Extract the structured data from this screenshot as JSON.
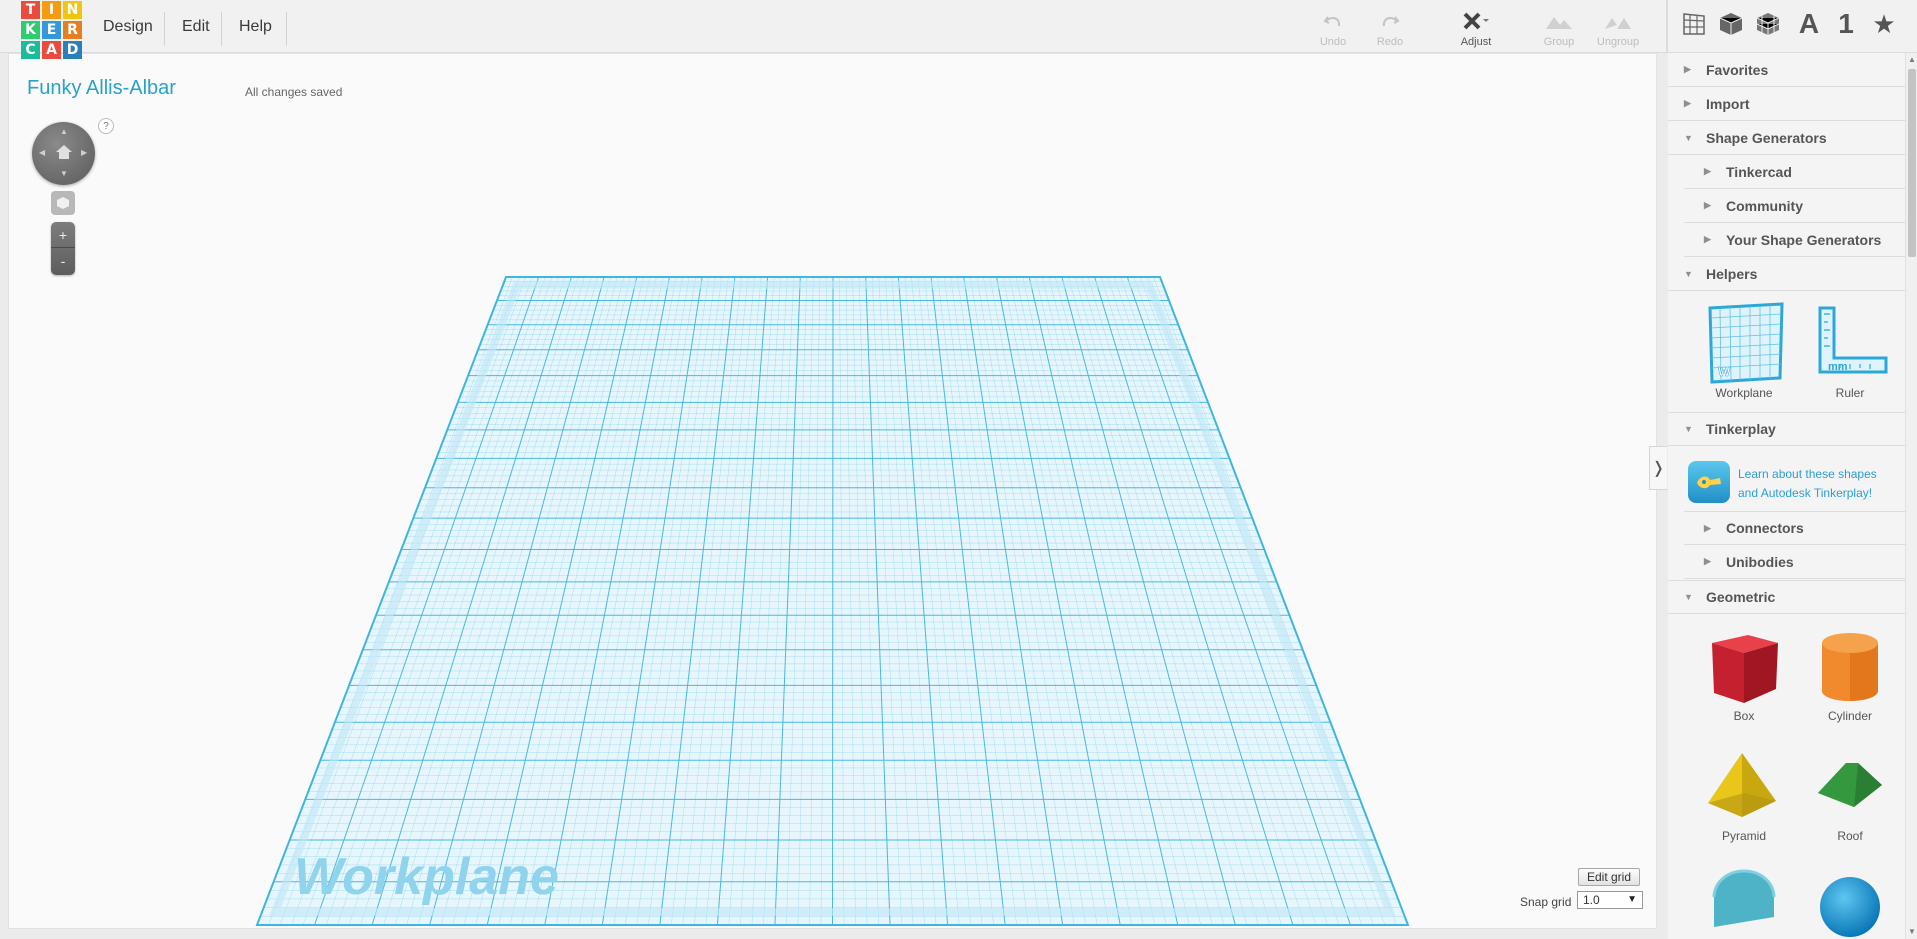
{
  "logo": {
    "letters": [
      "T",
      "I",
      "N",
      "K",
      "E",
      "R",
      "C",
      "A",
      "D"
    ],
    "colors": [
      "#e94c3c",
      "#f39c12",
      "#f1c40f",
      "#2ecc71",
      "#3498db",
      "#e67e22",
      "#1abc9c",
      "#e74c3c",
      "#2980b9"
    ]
  },
  "menu": {
    "design": "Design",
    "edit": "Edit",
    "help": "Help"
  },
  "toolbar": {
    "undo": "Undo",
    "redo": "Redo",
    "adjust": "Adjust",
    "group": "Group",
    "ungroup": "Ungroup"
  },
  "view_buttons": {
    "grid_icon": "grid-view-icon",
    "box_icon": "solid-view-icon",
    "wire_icon": "wireframe-view-icon",
    "text": "A",
    "number": "1",
    "star": "★"
  },
  "design": {
    "title": "Funky Allis-Albar",
    "status": "All changes saved"
  },
  "nav": {
    "help": "?",
    "zoom_in": "+",
    "zoom_out": "-"
  },
  "workplane": {
    "label": "Workplane",
    "color": "#3fb6dc"
  },
  "grid": {
    "edit_label": "Edit grid",
    "snap_label": "Snap grid",
    "snap_value": "1.0"
  },
  "collapse": {
    "glyph": "❭"
  },
  "sidebar": {
    "favorites": "Favorites",
    "import": "Import",
    "shape_generators": "Shape Generators",
    "tinkercad": "Tinkercad",
    "community": "Community",
    "your_generators": "Your Shape Generators",
    "helpers": "Helpers",
    "helper_items": [
      "Workplane",
      "Ruler"
    ],
    "workplane_letter": "W",
    "ruler_unit": "mm",
    "tinkerplay": "Tinkerplay",
    "tinkerplay_text": "Learn about these shapes and Autodesk Tinkerplay!",
    "connectors": "Connectors",
    "unibodies": "Unibodies",
    "geometric": "Geometric",
    "shapes": [
      "Box",
      "Cylinder",
      "Pyramid",
      "Roof"
    ]
  }
}
